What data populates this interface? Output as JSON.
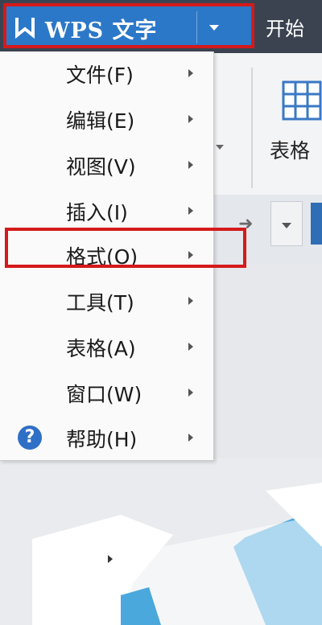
{
  "app": {
    "title": "WPS 文字",
    "logo_icon": "wps-logo-icon",
    "accent_color": "#2c78c8"
  },
  "ribbon": {
    "tab_start": "开始",
    "table_label": "表格"
  },
  "menu": {
    "items": [
      {
        "label": "文件(F)"
      },
      {
        "label": "编辑(E)"
      },
      {
        "label": "视图(V)"
      },
      {
        "label": "插入(I)"
      },
      {
        "label": "格式(O)"
      },
      {
        "label": "工具(T)"
      },
      {
        "label": "表格(A)"
      },
      {
        "label": "窗口(W)"
      },
      {
        "label": "帮助(H)",
        "icon": "help-icon"
      }
    ],
    "highlighted_item": "格式(O)",
    "highlight_color": "#d41a1a"
  }
}
